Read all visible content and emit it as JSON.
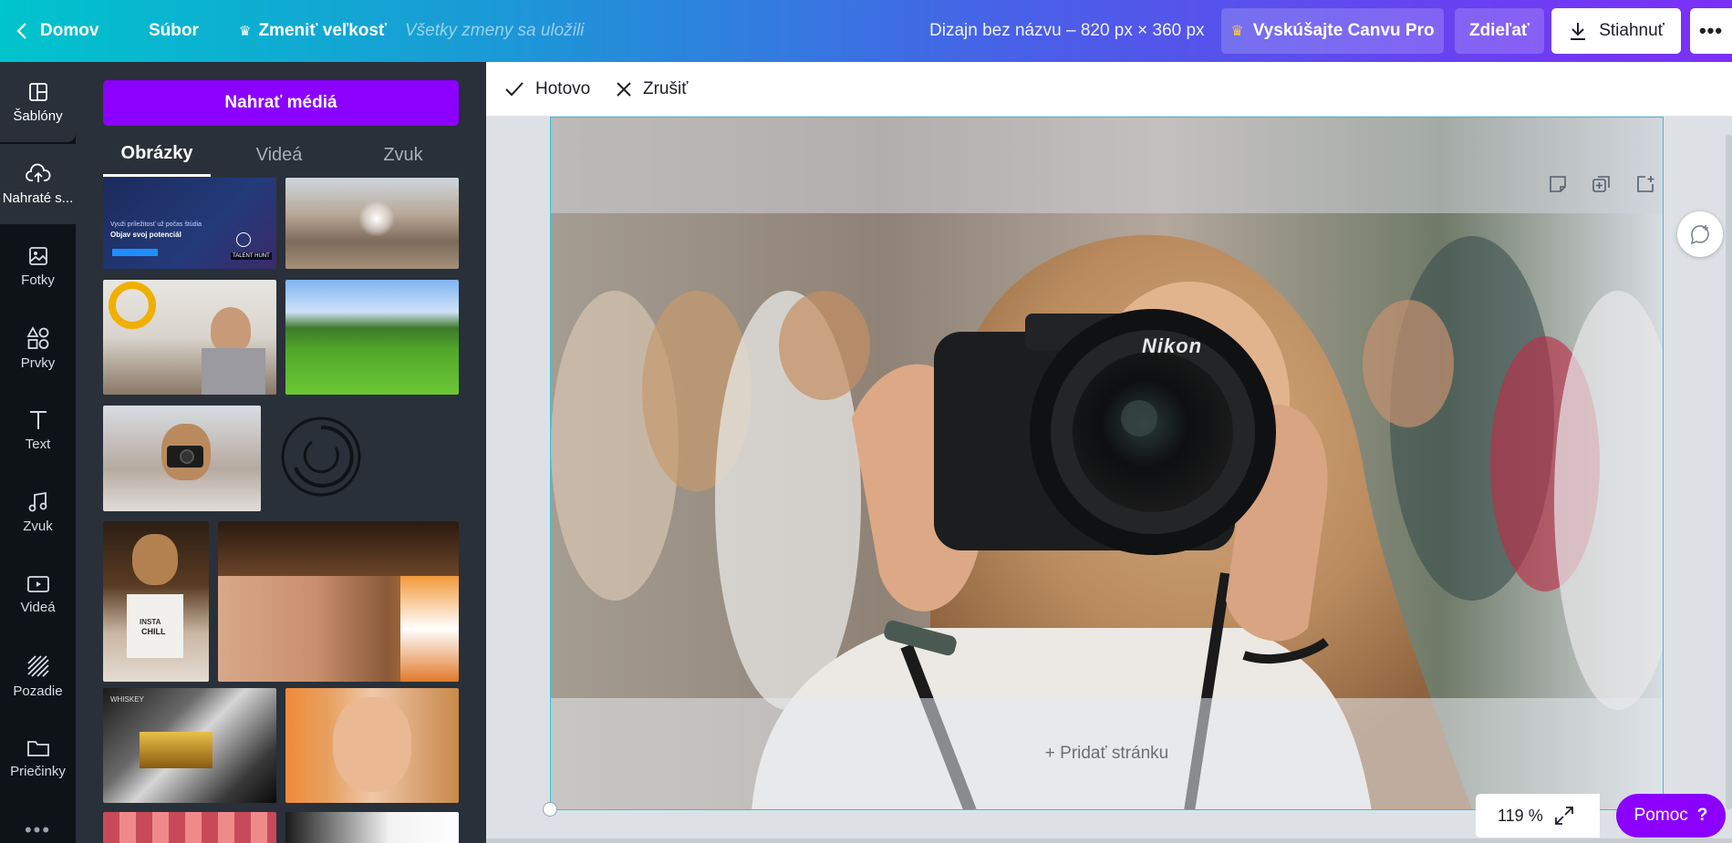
{
  "topbar": {
    "home_label": "Domov",
    "file_label": "Súbor",
    "resize_label": "Zmeniť veľkosť",
    "saved_status": "Všetky zmeny sa uložili",
    "design_title": "Dizajn bez názvu – 820 px × 360 px",
    "pro_label": "Vyskúšajte Canvu Pro",
    "share_label": "Zdieľať",
    "download_label": "Stiahnuť",
    "more_label": "•••",
    "crown_icon": "♛"
  },
  "rail": {
    "items": [
      {
        "label": "Šablóny",
        "icon": "templates-icon"
      },
      {
        "label": "Nahraté s...",
        "icon": "upload-cloud-icon"
      },
      {
        "label": "Fotky",
        "icon": "photo-icon"
      },
      {
        "label": "Prvky",
        "icon": "elements-icon"
      },
      {
        "label": "Text",
        "icon": "text-icon"
      },
      {
        "label": "Zvuk",
        "icon": "music-icon"
      },
      {
        "label": "Videá",
        "icon": "video-icon"
      },
      {
        "label": "Pozadie",
        "icon": "background-icon"
      },
      {
        "label": "Priečinky",
        "icon": "folder-icon"
      }
    ],
    "more_label": "•••"
  },
  "panel": {
    "upload_button": "Nahrať médiá",
    "tabs": [
      "Obrázky",
      "Videá",
      "Zvuk"
    ],
    "thumb1_line1": "Využi príležitosť už počas štúdia",
    "thumb1_line2": "Objav svoj potenciál",
    "thumb1_badge": "TALENT HUNT",
    "thumb9_text1": "INSTA",
    "thumb9_text2": "CHILL",
    "thumb11_text": "WHISKEY"
  },
  "editbar": {
    "done_label": "Hotovo",
    "cancel_label": "Zrušiť"
  },
  "canvas": {
    "add_page_label": "+ Pridať stránku",
    "camera_brand": "Nikon"
  },
  "footer": {
    "zoom": "119 %",
    "help_label": "Pomoc",
    "help_q": "?"
  },
  "colors": {
    "accent_purple": "#8b00ff",
    "rail_bg": "#0e1318",
    "panel_bg": "#293039",
    "selection": "#31c2d8"
  }
}
